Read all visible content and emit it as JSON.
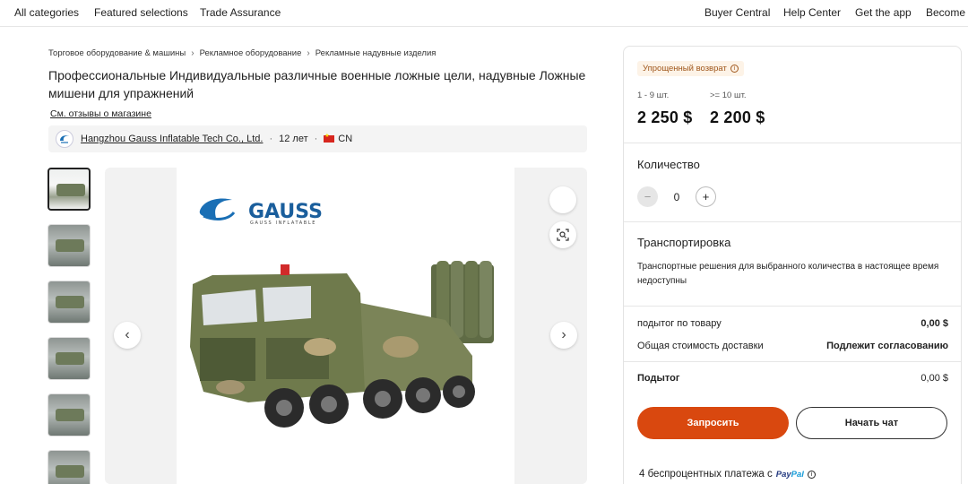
{
  "topnav": {
    "left": [
      "All categories",
      "Featured selections",
      "Trade Assurance"
    ],
    "right": [
      "Buyer Central",
      "Help Center",
      "Get the app",
      "Become a"
    ]
  },
  "breadcrumb": [
    "Торговое оборудование & машины",
    "Рекламное оборудование",
    "Рекламные надувные изделия"
  ],
  "product": {
    "title": "Профессиональные Индивидуальные различные военные ложные цели, надувные Ложные мишени для упражнений",
    "reviews_link": "См. отзывы о магазине"
  },
  "supplier": {
    "name": "Hangzhou Gauss Inflatable Tech Co., Ltd.",
    "years": "12 лет",
    "country": "CN"
  },
  "gallery": {
    "brand": "GAUSS",
    "brand_sub": "GAUSS INFLATABLE",
    "thumbnail_count": 6
  },
  "panel": {
    "return_badge": "Упрощенный возврат",
    "tiers": [
      {
        "qty": "1 - 9 шт.",
        "price": "2 250 $"
      },
      {
        "qty": ">= 10 шт.",
        "price": "2 200 $"
      }
    ],
    "quantity_title": "Количество",
    "quantity_value": "0",
    "shipping_title": "Транспортировка",
    "shipping_text": "Транспортные решения для выбранного количества в настоящее время недоступны",
    "subtotal_label": "подытог по товару",
    "subtotal_value": "0,00 $",
    "shipping_cost_label": "Общая стоимость доставки",
    "shipping_cost_value": "Подлежит согласованию",
    "total_label": "Подытог",
    "total_value": "0,00 $",
    "request_button": "Запросить",
    "chat_button": "Начать чат",
    "payment_text": "4 беспроцентных платежа с",
    "paypal": {
      "pay": "Pay",
      "pal": "Pal"
    }
  },
  "colors": {
    "accent": "#d9480f",
    "badge_bg": "#fdf3e7",
    "badge_text": "#a0571c",
    "brand_blue": "#1a6fb5"
  }
}
